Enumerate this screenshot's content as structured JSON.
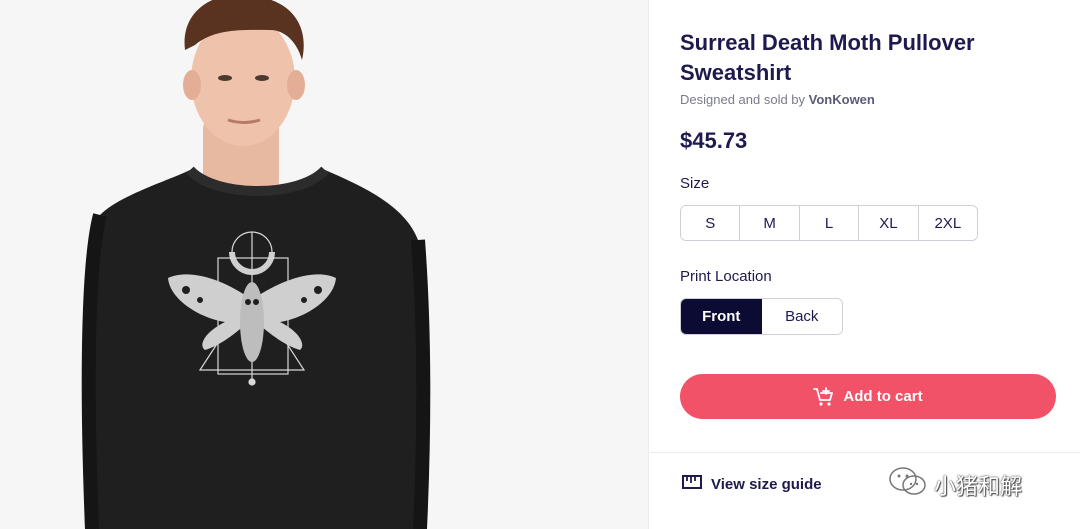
{
  "product": {
    "title": "Surreal Death Moth Pullover Sweatshirt",
    "designer_prefix": "Designed and sold by",
    "designer_name": "VonKowen",
    "price": "$45.73"
  },
  "size": {
    "label": "Size",
    "options": [
      "S",
      "M",
      "L",
      "XL",
      "2XL"
    ]
  },
  "print_location": {
    "label": "Print Location",
    "options": [
      "Front",
      "Back"
    ],
    "selected": "Front"
  },
  "cart": {
    "label": "Add to cart",
    "icon": "cart-plus-icon"
  },
  "size_guide": {
    "label": "View size guide",
    "icon": "ruler-icon"
  },
  "watermark": {
    "text": "小猪和解",
    "icon": "wechat-icon"
  },
  "colors": {
    "accent": "#f25268",
    "selected_bg": "#0c0b33",
    "text": "#1d1a4e",
    "sweatshirt": "#1f1f1f"
  }
}
